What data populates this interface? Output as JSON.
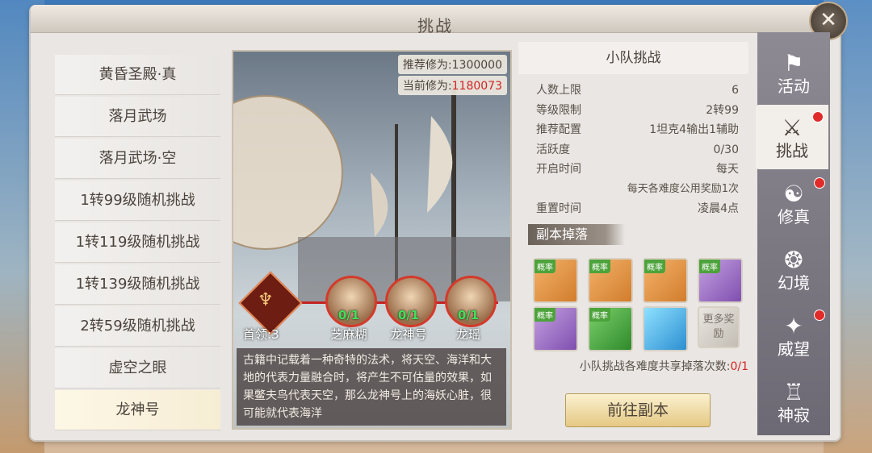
{
  "title": "挑战",
  "list": [
    "黄昏圣殿·真",
    "落月武场",
    "落月武场·空",
    "1转99级随机挑战",
    "1转119级随机挑战",
    "1转139级随机挑战",
    "2转59级随机挑战",
    "虚空之眼",
    "龙神号"
  ],
  "recommend": {
    "label": "推荐修为:",
    "value": "1300000"
  },
  "current": {
    "label": "当前修为:",
    "value": "1180073"
  },
  "boss_lead": "首领:3",
  "bosses": [
    {
      "count": "0/1",
      "name": "芝麻糊"
    },
    {
      "count": "0/1",
      "name": "龙神号"
    },
    {
      "count": "0/1",
      "name": "龙瑶"
    }
  ],
  "description": "古籍中记载着一种奇特的法术，将天空、海洋和大地的代表力量融合时，将产生不可估量的效果，如果鳖夫鸟代表天空，那么龙神号上的海妖心脏，很可能就代表海洋",
  "info": {
    "header": "小队挑战",
    "rows": [
      {
        "k": "人数上限",
        "v": "6"
      },
      {
        "k": "等级限制",
        "v": "2转99"
      },
      {
        "k": "推荐配置",
        "v": "1坦克4输出1辅助"
      },
      {
        "k": "活跃度",
        "v": "0/30"
      },
      {
        "k": "开启时间",
        "v": "每天"
      }
    ],
    "note": "每天各难度公用奖励1次",
    "reset": {
      "k": "重置时间",
      "v": "凌晨4点"
    },
    "drops_header": "副本掉落",
    "drop_tag": "概率",
    "more_rewards": "更多奖励",
    "share_label": "小队挑战各难度共享掉落次数:",
    "share_value": "0/1",
    "go_button": "前往副本"
  },
  "tabs": [
    {
      "label": "活动",
      "icon": "activity-icon"
    },
    {
      "label": "挑战",
      "icon": "challenge-icon"
    },
    {
      "label": "修真",
      "icon": "cultivation-icon"
    },
    {
      "label": "幻境",
      "icon": "illusion-icon"
    },
    {
      "label": "威望",
      "icon": "prestige-icon"
    },
    {
      "label": "神寂",
      "icon": "divine-icon"
    }
  ]
}
